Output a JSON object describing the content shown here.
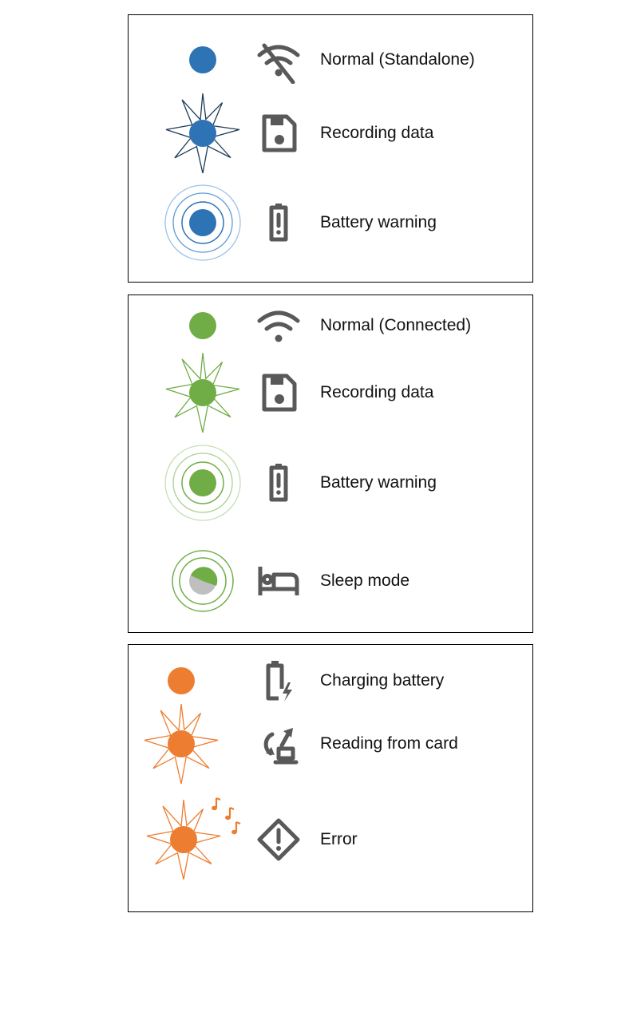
{
  "colors": {
    "blue": "#2e74b5",
    "blue_outline": "#1f3b5a",
    "blue_light": "#9dc3e6",
    "green": "#70ad47",
    "green_light": "#a9d18e",
    "orange": "#ed7d31",
    "gray_icon": "#595959",
    "gray_fill": "#bfbfbf"
  },
  "panels": [
    {
      "group": "standalone",
      "rows": [
        {
          "led": "solid",
          "led_color": "blue",
          "icon": "wifi-off-icon",
          "label": "Normal (Standalone)"
        },
        {
          "led": "flash",
          "led_color": "blue",
          "icon": "save-icon",
          "label": "Recording data"
        },
        {
          "led": "pulse",
          "led_color": "blue",
          "icon": "battery-alert-icon",
          "label": "Battery warning"
        }
      ]
    },
    {
      "group": "connected",
      "rows": [
        {
          "led": "solid",
          "led_color": "green",
          "icon": "wifi-icon",
          "label": "Normal (Connected)"
        },
        {
          "led": "flash",
          "led_color": "green",
          "icon": "save-icon",
          "label": "Recording data"
        },
        {
          "led": "pulse",
          "led_color": "green",
          "icon": "battery-alert-icon",
          "label": "Battery warning"
        },
        {
          "led": "sleep",
          "led_color": "green",
          "icon": "bed-icon",
          "label": "Sleep mode"
        }
      ]
    },
    {
      "group": "orange",
      "rows": [
        {
          "led": "solid",
          "led_color": "orange",
          "icon": "battery-charging-icon",
          "label": "Charging battery"
        },
        {
          "led": "flash",
          "led_color": "orange",
          "icon": "card-read-icon",
          "label": "Reading from card"
        },
        {
          "led": "flash-beep",
          "led_color": "orange",
          "icon": "error-diamond-icon",
          "label": "Error"
        }
      ]
    }
  ]
}
